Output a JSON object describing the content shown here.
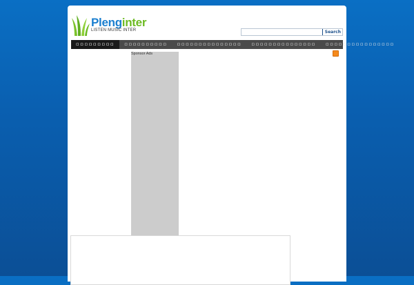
{
  "logo": {
    "name_part1": "Pleng",
    "name_part2": "inter",
    "tagline": "LISTEN MUSIC INTER"
  },
  "search": {
    "value": "",
    "placeholder": "",
    "button_label": "Search"
  },
  "nav": {
    "items": [
      {
        "label": "▫▫▫▫▫▫▫▫▫",
        "active": true
      },
      {
        "label": "▫▫▫▫▫▫▫▫▫▫",
        "active": false
      },
      {
        "label": "▫▫▫▫▫▫▫▫▫▫▫▫▫▫▫",
        "active": false
      },
      {
        "label": "▫▫▫▫▫▫▫▫▫▫▫▫▫▫▫",
        "active": false
      },
      {
        "label": "▫▫▫▫▫▫▫▫▫▫▫▫▫▫▫▫",
        "active": false
      }
    ]
  },
  "sidebar_ads": {
    "label": "Sponsor Ads"
  },
  "icons": {
    "rss": "rss-icon",
    "logo": "grass-logo-icon"
  },
  "colors": {
    "background": "#0a5fb0",
    "brand_blue": "#1b7fcf",
    "brand_green": "#6dbb23",
    "nav_bg": "#4a4a4a",
    "nav_active_bg": "#1a1a1a",
    "rss": "#f58a1c"
  }
}
